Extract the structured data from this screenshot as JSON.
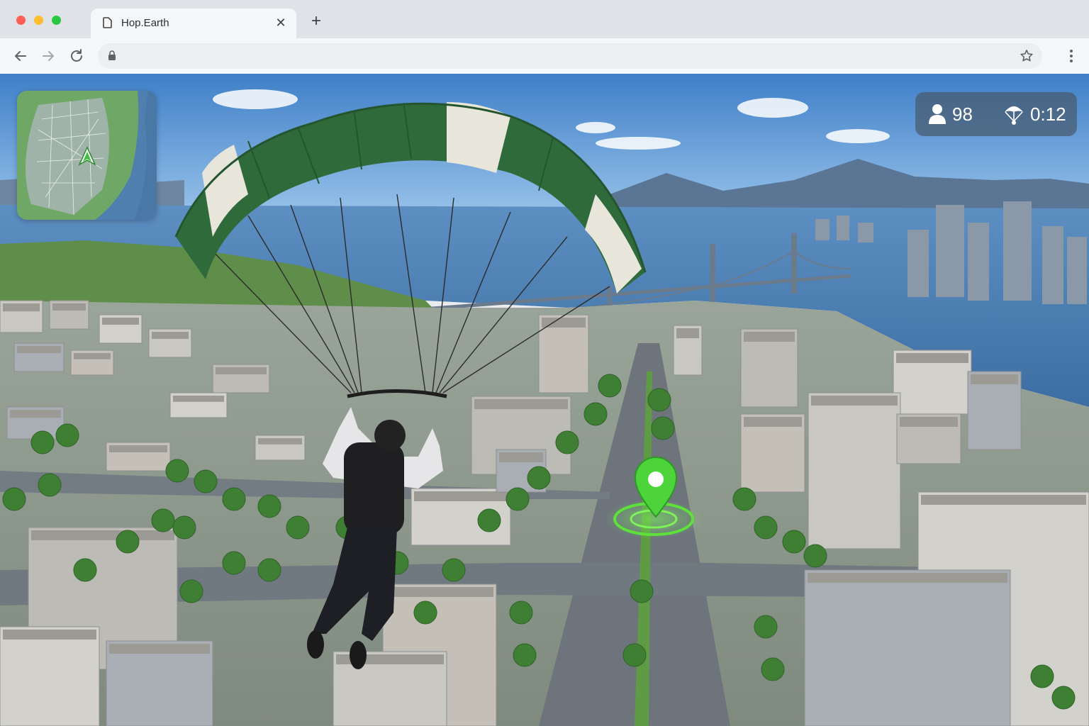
{
  "browser": {
    "tab": {
      "title": "Hop.Earth",
      "close_icon": "close-icon",
      "page_icon": "page-icon"
    },
    "new_tab_icon": "plus-icon",
    "toolbar": {
      "back_icon": "back-arrow-icon",
      "forward_icon": "forward-arrow-icon",
      "reload_icon": "reload-icon",
      "lock_icon": "lock-icon",
      "url": "",
      "bookmark_icon": "star-icon",
      "menu_icon": "kebab-menu-icon"
    }
  },
  "game": {
    "hud": {
      "players_icon": "person-icon",
      "players_count": "98",
      "parachute_icon": "parachute-icon",
      "timer": "0:12"
    },
    "minimap": {
      "player_marker_icon": "arrow-marker-icon"
    },
    "waypoint_icon": "map-pin-icon",
    "colors": {
      "waypoint": "#4cd43a",
      "canopy_green": "#2f6b3a",
      "canopy_white": "#e8e6da",
      "hud_bg": "#465a6e"
    }
  }
}
